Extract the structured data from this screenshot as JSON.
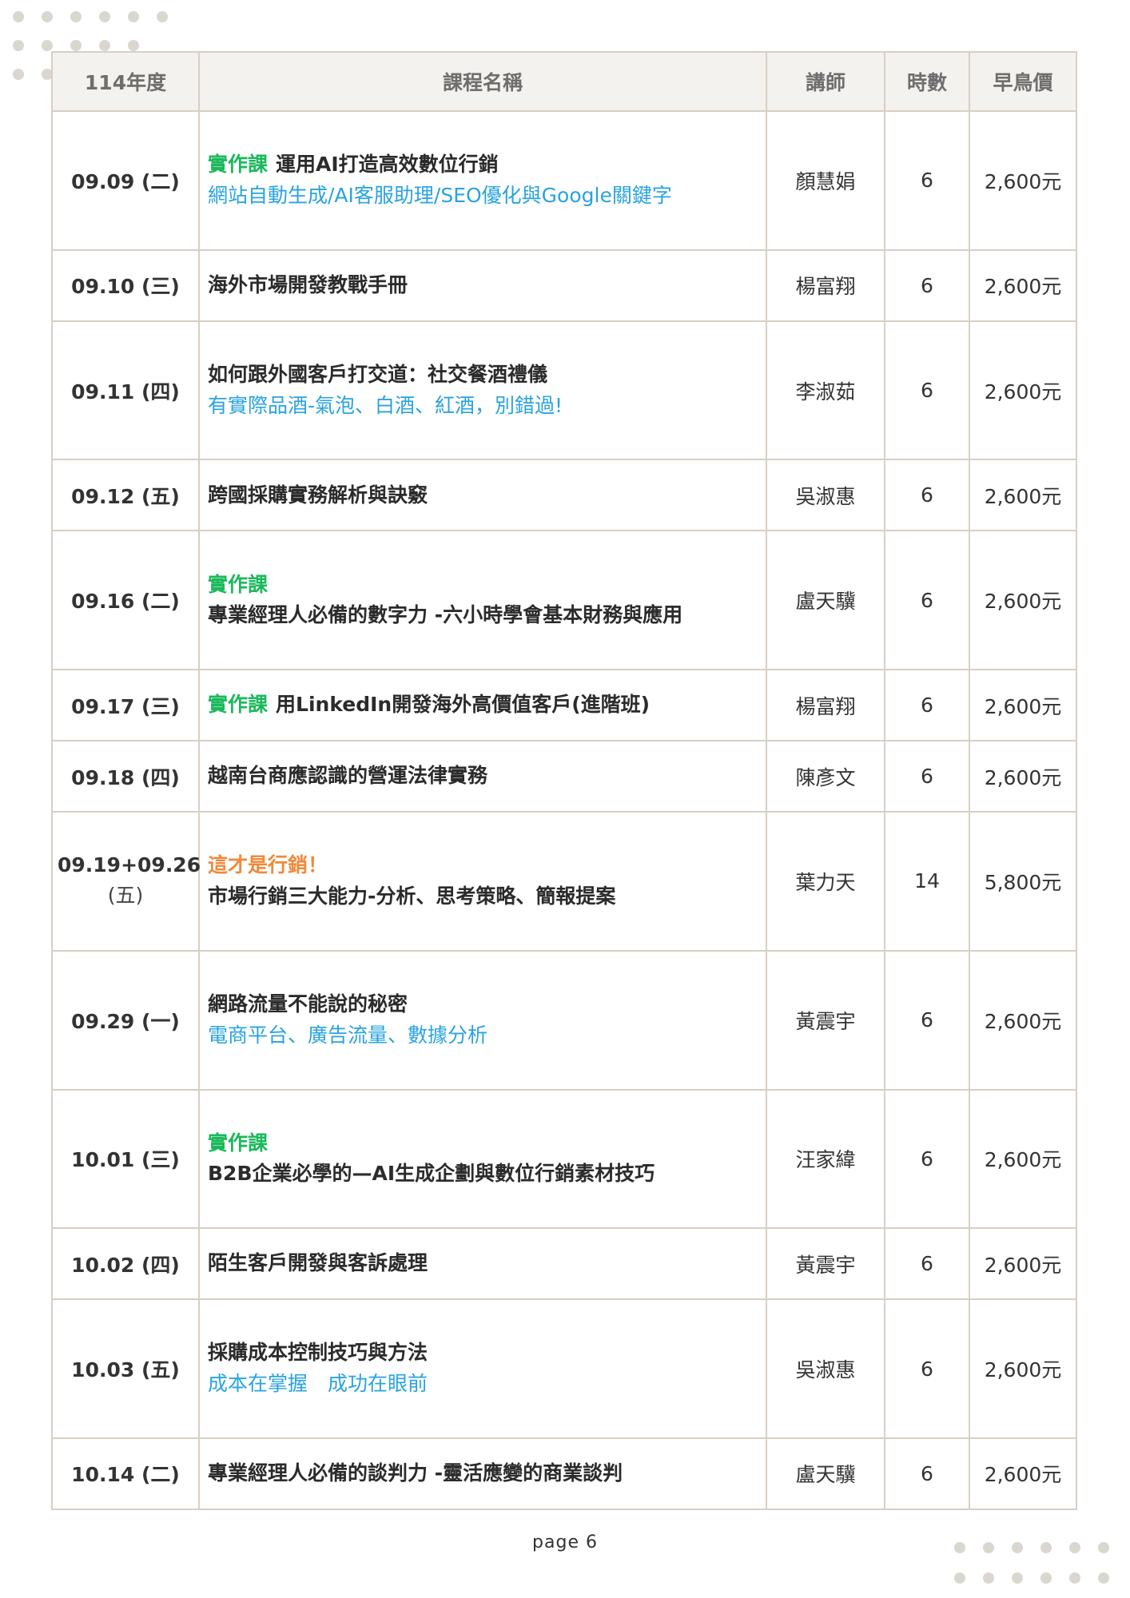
{
  "header": {
    "year": "114年度",
    "course": "課程名稱",
    "teacher": "講師",
    "hours": "時數",
    "price": "早鳥價"
  },
  "colors": {
    "practice_tag": "#1ab95b",
    "marketing_tag": "#f0893a",
    "subtitle": "#29a3df",
    "border": "#d8cfc4",
    "header_bg": "#f4f2ee"
  },
  "rows": [
    {
      "date": "09.09 (二)",
      "tag": "實作課",
      "title": "運用AI打造高效數位行銷",
      "sub": "網站自動生成/AI客服助理/SEO優化與Google關鍵字",
      "teacher": "顏慧娟",
      "hours": "6",
      "price": "2,600元"
    },
    {
      "date": "09.10 (三)",
      "title": "海外市場開發教戰手冊",
      "teacher": "楊富翔",
      "hours": "6",
      "price": "2,600元"
    },
    {
      "date": "09.11 (四)",
      "title": "如何跟外國客戶打交道：社交餐酒禮儀",
      "sub": "有實際品酒-氣泡、白酒、紅酒，別錯過!",
      "teacher": "李淑茹",
      "hours": "6",
      "price": "2,600元"
    },
    {
      "date": "09.12 (五)",
      "title": "跨國採購實務解析與訣竅",
      "teacher": "吳淑惠",
      "hours": "6",
      "price": "2,600元"
    },
    {
      "date": "09.16 (二)",
      "tag": "實作課",
      "title": "專業經理人必備的數字力 -六小時學會基本財務與應用",
      "teacher": "盧天驥",
      "hours": "6",
      "price": "2,600元"
    },
    {
      "date": "09.17 (三)",
      "tag": "實作課",
      "title": "用LinkedIn開發海外高價值客戶(進階班)",
      "teacher": "楊富翔",
      "hours": "6",
      "price": "2,600元"
    },
    {
      "date": "09.18 (四)",
      "title": "越南台商應認識的營運法律實務",
      "teacher": "陳彥文",
      "hours": "6",
      "price": "2,600元"
    },
    {
      "date": "09.19+09.26",
      "date2": "(五)",
      "tag": "這才是行銷！",
      "title": "市場行銷三大能力-分析、思考策略、簡報提案",
      "teacher": "葉力天",
      "hours": "14",
      "price": "5,800元"
    },
    {
      "date": "09.29 (一)",
      "title": "網路流量不能說的秘密",
      "sub": "電商平台、廣告流量、數據分析",
      "teacher": "黃震宇",
      "hours": "6",
      "price": "2,600元"
    },
    {
      "date": "10.01 (三)",
      "tag": "實作課",
      "title": "B2B企業必學的—AI生成企劃與數位行銷素材技巧",
      "teacher": "汪家緯",
      "hours": "6",
      "price": "2,600元"
    },
    {
      "date": "10.02 (四)",
      "title": "陌生客戶開發與客訴處理",
      "teacher": "黃震宇",
      "hours": "6",
      "price": "2,600元"
    },
    {
      "date": "10.03 (五)",
      "title": "採購成本控制技巧與方法",
      "sub": "成本在掌握　成功在眼前",
      "teacher": "吳淑惠",
      "hours": "6",
      "price": "2,600元"
    },
    {
      "date": "10.14 (二)",
      "title": "專業經理人必備的談判力 -靈活應變的商業談判",
      "teacher": "盧天驥",
      "hours": "6",
      "price": "2,600元"
    }
  ],
  "footer": {
    "page": "page 6"
  }
}
